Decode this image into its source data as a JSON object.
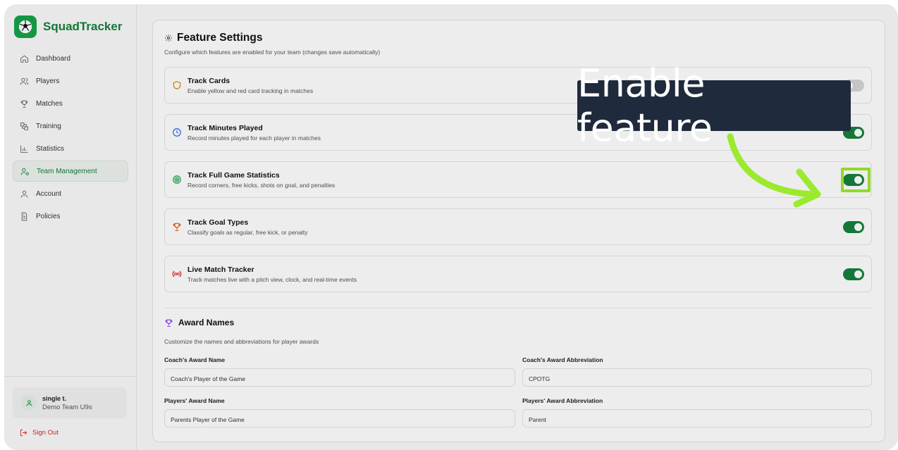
{
  "app": {
    "name": "SquadTracker"
  },
  "sidebar": {
    "items": [
      {
        "label": "Dashboard",
        "icon": "home-icon",
        "active": false
      },
      {
        "label": "Players",
        "icon": "users-icon",
        "active": false
      },
      {
        "label": "Matches",
        "icon": "trophy-icon",
        "active": false
      },
      {
        "label": "Training",
        "icon": "training-icon",
        "active": false
      },
      {
        "label": "Statistics",
        "icon": "bar-chart-icon",
        "active": false
      },
      {
        "label": "Team Management",
        "icon": "user-cog-icon",
        "active": true
      },
      {
        "label": "Account",
        "icon": "user-icon",
        "active": false
      },
      {
        "label": "Policies",
        "icon": "document-icon",
        "active": false
      }
    ],
    "user": {
      "name": "single t.",
      "team": "Demo Team U9s"
    },
    "sign_out": "Sign Out"
  },
  "feature_settings": {
    "title": "Feature Settings",
    "description": "Configure which features are enabled for your team (changes save automatically)",
    "features": [
      {
        "title": "Track Cards",
        "description": "Enable yellow and red card tracking in matches",
        "icon": "shield-icon",
        "enabled": false
      },
      {
        "title": "Track Minutes Played",
        "description": "Record minutes played for each player in matches",
        "icon": "clock-icon",
        "enabled": true
      },
      {
        "title": "Track Full Game Statistics",
        "description": "Record corners, free kicks, shots on goal, and penalties",
        "icon": "target-icon",
        "enabled": true
      },
      {
        "title": "Track Goal Types",
        "description": "Classify goals as regular, free kick, or penalty",
        "icon": "trophy-icon",
        "enabled": true
      },
      {
        "title": "Live Match Tracker",
        "description": "Track matches live with a pitch view, clock, and real-time events",
        "icon": "broadcast-icon",
        "enabled": true
      }
    ]
  },
  "award_names": {
    "title": "Award Names",
    "description": "Customize the names and abbreviations for player awards",
    "coach_name_label": "Coach's Award Name",
    "coach_name_value": "Coach's Player of the Game",
    "coach_abbr_label": "Coach's Award Abbreviation",
    "coach_abbr_value": "CPOTG",
    "players_name_label": "Players' Award Name",
    "players_name_value": "Parents Player of the Game",
    "players_abbr_label": "Players' Award Abbreviation",
    "players_abbr_value": "Parent"
  },
  "callout": {
    "text": "Enable feature"
  },
  "colors": {
    "brand": "#15803d",
    "toggle_on": "#15803d",
    "highlight": "#9bea2e",
    "callout_bg": "#1f2a3c",
    "sign_out": "#dc2626"
  }
}
